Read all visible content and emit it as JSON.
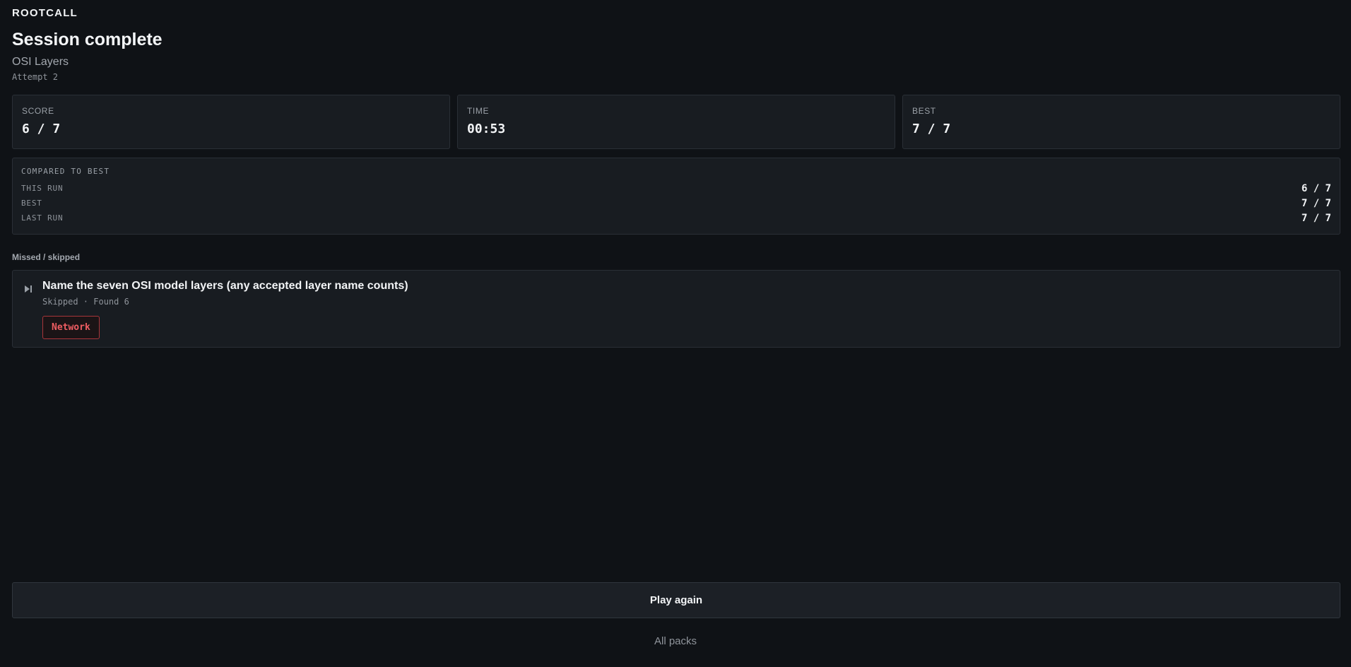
{
  "app": {
    "brand": "ROOTCALL"
  },
  "header": {
    "title": "Session complete",
    "subtitle": "OSI Layers",
    "attempt": "Attempt 2"
  },
  "stats": [
    {
      "label": "SCORE",
      "value": "6 / 7"
    },
    {
      "label": "TIME",
      "value": "00:53"
    },
    {
      "label": "BEST",
      "value": "7 / 7"
    }
  ],
  "compare": {
    "title": "COMPARED TO BEST",
    "rows": [
      {
        "label": "THIS RUN",
        "value": "6 / 7"
      },
      {
        "label": "BEST",
        "value": "7 / 7"
      },
      {
        "label": "LAST RUN",
        "value": "7 / 7"
      }
    ]
  },
  "missed": {
    "section_label": "Missed / skipped",
    "items": [
      {
        "icon": "skip-icon",
        "question": "Name the seven OSI model layers (any accepted layer name counts)",
        "meta": "Skipped · Found 6",
        "tag": "Network"
      }
    ]
  },
  "actions": {
    "play_again": "Play again",
    "all_packs": "All packs"
  },
  "colors": {
    "background": "#0f1216",
    "card": "#181c21",
    "border": "#2a2f36",
    "tag_red": "#ef5d62"
  }
}
